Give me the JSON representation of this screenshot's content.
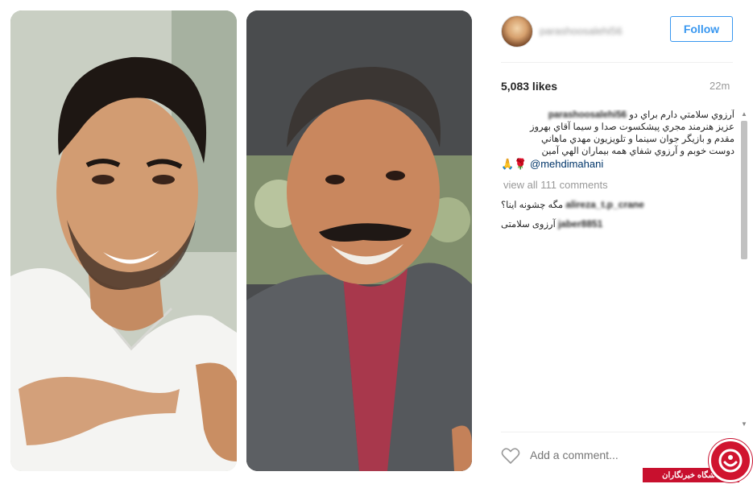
{
  "post": {
    "username": "parashoosalehi56",
    "follow_label": "Follow",
    "likes": "5,083 likes",
    "time": "22m",
    "caption_lines": [
      "آرزوي سلامتي دارم براي دو",
      "عزيز هنرمند مجري پيشكسوت صدا و سيما آقاي بهروز",
      "مقدم و بازيگر جوان سينما و تلويزيون مهدي ماهاني",
      "دوست خوبم و آرزوي شفاي همه بيماران الهي آمين"
    ],
    "caption_emoji": "🙏🌹",
    "caption_mention": "@mehdimahani",
    "view_all_comments": "view all 111 comments",
    "comments": [
      {
        "user": "alireza_t.p_crane",
        "text": "مگه چشونه اینا؟"
      },
      {
        "user": "jaber8851",
        "text": "آرزوی سلامتی"
      }
    ],
    "add_comment_placeholder": "Add a comment..."
  },
  "watermark": {
    "text": "باشگاه خبرنگاران"
  },
  "icons": {
    "heart": "heart-icon",
    "scroll_up": "scroll-up-icon",
    "scroll_down": "scroll-down-icon"
  },
  "colors": {
    "follow_blue": "#3897f0",
    "mention_blue": "#003569",
    "watermark_red": "#c8102e"
  }
}
